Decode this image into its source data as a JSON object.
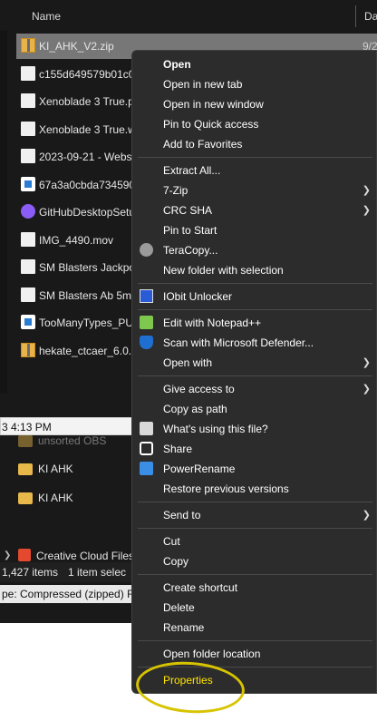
{
  "explorer": {
    "column_name": "Name",
    "column_date": "Da",
    "files": [
      {
        "name": "KI_AHK_V2.zip",
        "date": "9/2",
        "icon": "zip-folder-icon",
        "selected": true
      },
      {
        "name": "c155d649579b01c04",
        "date": "",
        "icon": "mp4-icon"
      },
      {
        "name": "Xenoblade 3 True.p",
        "date": "",
        "icon": "audio-icon"
      },
      {
        "name": "Xenoblade 3 True.w",
        "date": "",
        "icon": "mp4-icon"
      },
      {
        "name": "2023-09-21 - Webs",
        "date": "",
        "icon": "mp4-icon"
      },
      {
        "name": "67a3a0cbda734590",
        "date": "",
        "icon": "file-icon"
      },
      {
        "name": "GitHubDesktopSetu",
        "date": "",
        "icon": "github-icon"
      },
      {
        "name": "IMG_4490.mov",
        "date": "",
        "icon": "mp4-icon"
      },
      {
        "name": "SM Blasters Jackpo",
        "date": "",
        "icon": "mp4-icon"
      },
      {
        "name": "SM Blasters Ab 5m",
        "date": "",
        "icon": "mp4-icon"
      },
      {
        "name": "TooManyTypes_PU",
        "date": "",
        "icon": "file-icon"
      },
      {
        "name": "hekate_ctcaer_6.0.6",
        "date": "",
        "icon": "zip-folder-icon"
      }
    ]
  },
  "lower_window": {
    "time": "3 4:13 PM",
    "folders": [
      "unsorted OBS",
      "KI AHK",
      "KI AHK"
    ],
    "creative_cloud": "Creative Cloud Files",
    "item_count": "1,427 items",
    "selected_count": "1 item selec",
    "type_text": "pe: Compressed (zipped) Fo"
  },
  "context_menu": {
    "groups": [
      [
        {
          "label": "Open",
          "bold": true
        },
        {
          "label": "Open in new tab"
        },
        {
          "label": "Open in new window"
        },
        {
          "label": "Pin to Quick access"
        },
        {
          "label": "Add to Favorites"
        }
      ],
      [
        {
          "label": "Extract All..."
        },
        {
          "label": "7-Zip",
          "submenu": true
        },
        {
          "label": "CRC SHA",
          "submenu": true
        },
        {
          "label": "Pin to Start"
        },
        {
          "label": "TeraCopy...",
          "icon": "teracopy-icon"
        },
        {
          "label": "New folder with selection"
        }
      ],
      [
        {
          "label": "IObit Unlocker",
          "icon": "iobit-unlocker-icon"
        }
      ],
      [
        {
          "label": "Edit with Notepad++",
          "icon": "notepad-plus-plus-icon"
        },
        {
          "label": "Scan with Microsoft Defender...",
          "icon": "defender-shield-icon"
        },
        {
          "label": "Open with",
          "submenu": true
        }
      ],
      [
        {
          "label": "Give access to",
          "submenu": true
        },
        {
          "label": "Copy as path"
        },
        {
          "label": "What's using this file?",
          "icon": "lock-icon"
        },
        {
          "label": "Share",
          "icon": "share-icon"
        },
        {
          "label": "PowerRename",
          "icon": "power-rename-icon"
        },
        {
          "label": "Restore previous versions"
        }
      ],
      [
        {
          "label": "Send to",
          "submenu": true
        }
      ],
      [
        {
          "label": "Cut"
        },
        {
          "label": "Copy"
        }
      ],
      [
        {
          "label": "Create shortcut"
        },
        {
          "label": "Delete"
        },
        {
          "label": "Rename"
        }
      ],
      [
        {
          "label": "Open folder location"
        }
      ],
      [
        {
          "label": "Properties",
          "highlighted": true
        }
      ]
    ]
  },
  "colors": {
    "menu_bg": "#2c2c2c",
    "highlight": "#d7c400",
    "highlight_text": "#ffe400"
  }
}
